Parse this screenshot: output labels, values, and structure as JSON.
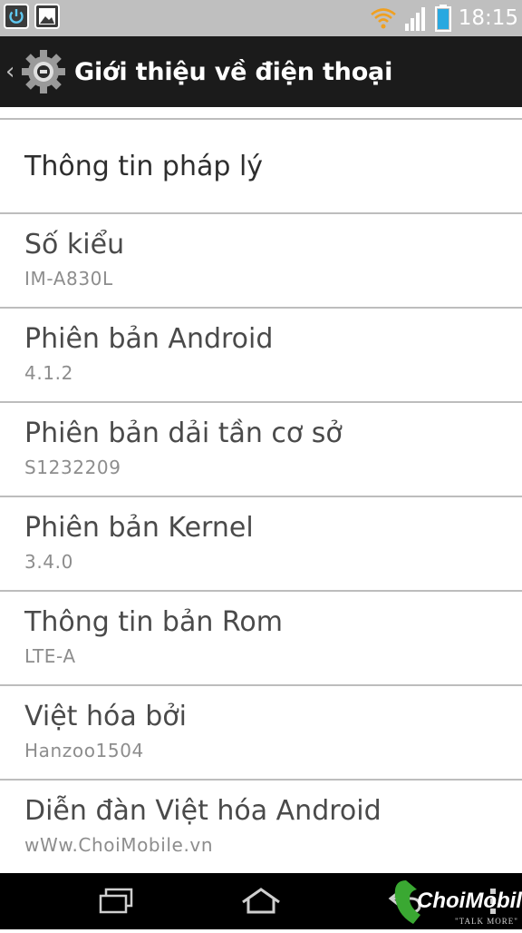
{
  "status_bar": {
    "time": "18:15",
    "icons": [
      "power-icon",
      "gallery-icon",
      "wifi-icon",
      "signal-icon",
      "battery-icon"
    ]
  },
  "action_bar": {
    "title": "Giới thiệu về điện thoại",
    "icons": [
      "back-chevron-icon",
      "settings-gear-icon"
    ]
  },
  "list": {
    "top_item": "Thông tin pháp lý",
    "items": [
      {
        "title": "Số kiểu",
        "value": "IM-A830L"
      },
      {
        "title": "Phiên bản Android",
        "value": "4.1.2"
      },
      {
        "title": "Phiên bản dải tần cơ sở",
        "value": "S1232209"
      },
      {
        "title": "Phiên bản Kernel",
        "value": "3.4.0"
      },
      {
        "title": "Thông tin bản Rom",
        "value": "LTE-A"
      },
      {
        "title": "Việt hóa bởi",
        "value": "Hanzoo1504"
      },
      {
        "title": "Diễn đàn Việt hóa Android",
        "value": "wWw.ChoiMobile.vn"
      }
    ]
  },
  "nav_bar": {
    "icons": [
      "recent-apps-icon",
      "home-icon",
      "back-icon",
      "menu-icon"
    ]
  },
  "watermark": {
    "brand": "ChoiMobile",
    "tagline": "\"TALK MORE\""
  },
  "colors": {
    "status_bar": "#bfbfbf",
    "action_bar": "#1b1b1b",
    "divider": "#bdbdbd",
    "battery": "#29a8e0",
    "wifi": "#f0a020"
  }
}
